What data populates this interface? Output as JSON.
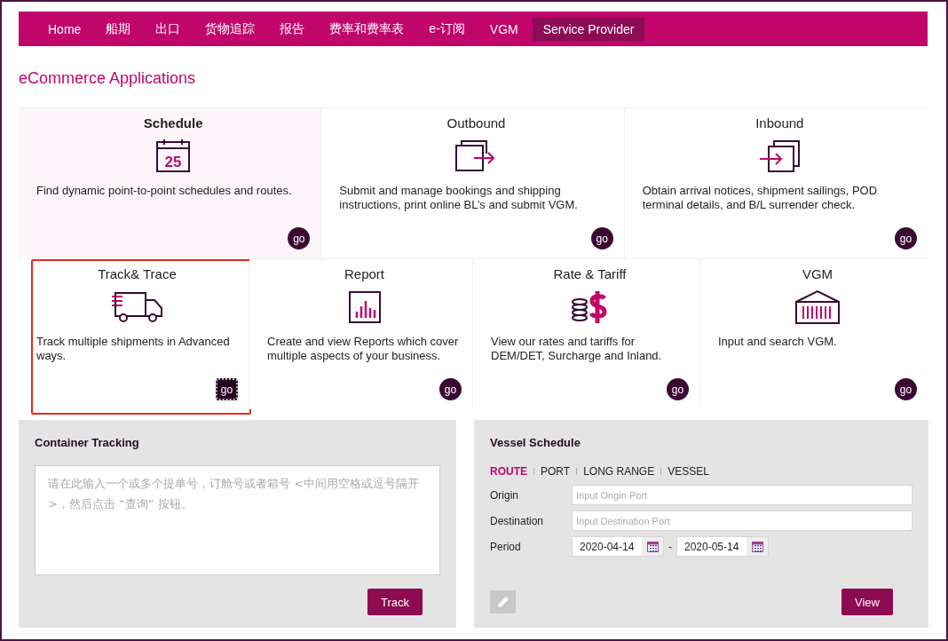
{
  "nav": {
    "items": [
      {
        "label": "Home",
        "selected": false
      },
      {
        "label": "船期",
        "selected": false
      },
      {
        "label": "出口",
        "selected": false
      },
      {
        "label": "货物追踪",
        "selected": false
      },
      {
        "label": "报告",
        "selected": false
      },
      {
        "label": "费率和费率表",
        "selected": false
      },
      {
        "label": "e-订阅",
        "selected": false
      },
      {
        "label": "VGM",
        "selected": false
      },
      {
        "label": "Service Provider",
        "selected": true
      }
    ]
  },
  "section_title": "eCommerce Applications",
  "app_rows": [
    [
      {
        "kind": "calendar",
        "title": "Schedule",
        "icon_text": "25",
        "description": "Find dynamic point-to-point schedules and routes.",
        "button": "go",
        "selected": true,
        "highlighted": false,
        "focused": false
      },
      {
        "kind": "outbound",
        "title": "Outbound",
        "description": "Submit and manage bookings and shipping instructions, print online BL’s and submit VGM.",
        "button": "go",
        "selected": false,
        "highlighted": false,
        "focused": false
      },
      {
        "kind": "inbound",
        "title": "Inbound",
        "description": "Obtain arrival notices, shipment sailings, POD terminal details, and B/L surrender check.",
        "button": "go",
        "selected": false,
        "highlighted": false,
        "focused": false
      }
    ],
    [
      {
        "kind": "truck",
        "title": "Track& Trace",
        "description": "Track multiple shipments in Advanced ways.",
        "button": "go",
        "selected": false,
        "highlighted": true,
        "focused": true
      },
      {
        "kind": "report",
        "title": "Report",
        "description": "Create and view Reports which cover multiple aspects of your business.",
        "button": "go",
        "selected": false,
        "highlighted": false,
        "focused": false
      },
      {
        "kind": "dollar",
        "title": "Rate & Tariff",
        "description": "View our rates and tariffs for DEM/DET, Surcharge and Inland.",
        "button": "go",
        "selected": false,
        "highlighted": false,
        "focused": false
      },
      {
        "kind": "container",
        "title": "VGM",
        "description": "Input and search VGM.",
        "button": "go",
        "selected": false,
        "highlighted": false,
        "focused": false
      }
    ]
  ],
  "container_tracking": {
    "title": "Container Tracking",
    "placeholder": "请在此输入一个或多个提单号，订舱号或者箱号 <中间用空格或逗号隔开>，然后点击 “查询” 按钮。",
    "button": "Track"
  },
  "vessel_schedule": {
    "title": "Vessel Schedule",
    "tabs": [
      {
        "label": "ROUTE",
        "selected": true
      },
      {
        "label": "PORT",
        "selected": false
      },
      {
        "label": "LONG RANGE",
        "selected": false
      },
      {
        "label": "VESSEL",
        "selected": false
      }
    ],
    "fields": [
      {
        "label": "Origin",
        "placeholder": "Input Origin Port"
      },
      {
        "label": "Destination",
        "placeholder": "Input Destination Port"
      }
    ],
    "period": {
      "label": "Period",
      "from": "2020-04-14",
      "separator": "-",
      "to": "2020-05-14"
    },
    "button": "View"
  }
}
